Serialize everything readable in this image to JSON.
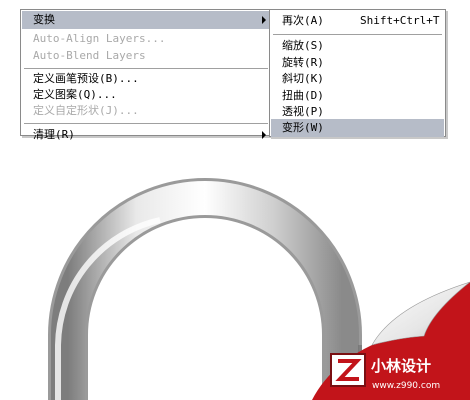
{
  "main_menu": {
    "items": [
      {
        "label": "变换"
      },
      {
        "label": "Auto-Align Layers..."
      },
      {
        "label": "Auto-Blend Layers"
      },
      {
        "label": "定义画笔预设(B)..."
      },
      {
        "label": "定义图案(Q)..."
      },
      {
        "label": "定义自定形状(J)..."
      },
      {
        "label": "清理(R)"
      }
    ]
  },
  "sub_menu": {
    "items": [
      {
        "label": "再次(A)",
        "shortcut": "Shift+Ctrl+T"
      },
      {
        "label": "缩放(S)"
      },
      {
        "label": "旋转(R)"
      },
      {
        "label": "斜切(K)"
      },
      {
        "label": "扭曲(D)"
      },
      {
        "label": "透视(P)"
      },
      {
        "label": "变形(W)"
      }
    ]
  },
  "watermark": {
    "brand": "小林设计",
    "url": "www.z990.com"
  },
  "colors": {
    "highlight": "#b6bcc8",
    "disabled_text": "#a9a9a9",
    "brand_red": "#c2141a"
  }
}
